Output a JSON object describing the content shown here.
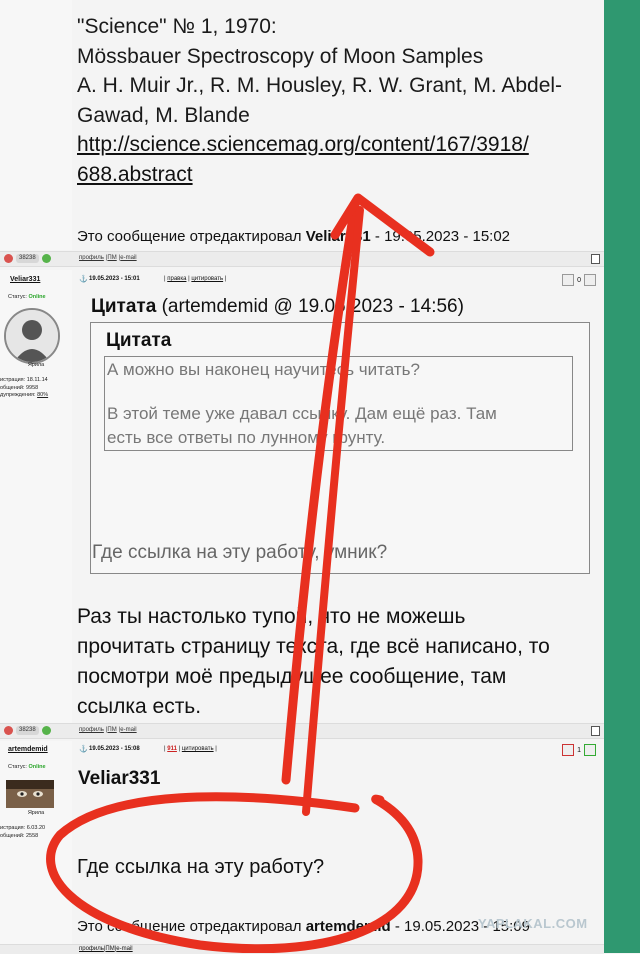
{
  "post1": {
    "lines": [
      "\"Science\" № 1, 1970:",
      "Mössbauer Spectroscopy of Moon Samples",
      "A. H. Muir Jr., R. M. Housley, R. W. Grant, M. Abdel-",
      "Gawad, M. Blande"
    ],
    "link_line1": "http://science.sciencemag.org/content/167/3918/",
    "link_line2": "688.abstract",
    "edited_prefix": "Это сообщение отредактировал ",
    "edited_user": "Veliar331",
    "edited_suffix": " - 19.05.2023 - 15:02"
  },
  "bar1": {
    "rep": "38238",
    "profile": "профиль",
    "pm": "ПМ",
    "email": "e-mail"
  },
  "post2": {
    "username": "Veliar331",
    "date": "19.05.2023 - 15:01",
    "actions": [
      "правка",
      "цитировать"
    ],
    "karma": "0",
    "status_label": "Статус: ",
    "status_value": "Online",
    "rank": "Ярила",
    "reg": "истрация: 18.11.14",
    "posts": "общений: 9958",
    "warn_label": "дупреждения: ",
    "warn_value": "80%",
    "quote_label": "Цитата",
    "quote_meta": " (artemdemid @ 19.05.2023 - 14:56)",
    "inner_quote_label": "Цитата",
    "inner_lines": [
      "А можно вы наконец научитесь читать?",
      "В этой теме уже давал ссылку. Дам ещё раз. Там",
      "есть все ответы по лунному грунту."
    ],
    "outer_quote_text": "Где ссылка на эту работу, умник?",
    "body_lines": [
      "Раз ты настолько тупой, что не можешь",
      "прочитать страницу текста, где всё написано, то",
      "посмотри моё предыдущее сообщение, там",
      "ссылка есть."
    ]
  },
  "bar2": {
    "rep": "38238",
    "profile": "профиль",
    "pm": "ПМ",
    "email": "e-mail"
  },
  "post3": {
    "username": "artemdemid",
    "date": "19.05.2023 - 15:08",
    "badge": "911",
    "action": "цитировать",
    "karma": "1",
    "status_label": "Статус: ",
    "status_value": "Online",
    "rank": "Ярила",
    "reg": "истрация: 6.03.20",
    "posts": "общений: 2558",
    "quoted_user": "Veliar331",
    "body": "Где ссылка на эту работу?",
    "edited_prefix": "Это сообщение отредактировал ",
    "edited_user": "artemdemid",
    "edited_suffix": " - 19.05.2023 - 15:09"
  },
  "bar3": {
    "profile": "профиль",
    "pm": "ПМ",
    "email": "e-mail"
  },
  "watermark": "YAPLAKAL.COM",
  "colors": {
    "annotation": "#e8301f",
    "sidebar": "#2f9870",
    "online": "#2aa52a"
  }
}
